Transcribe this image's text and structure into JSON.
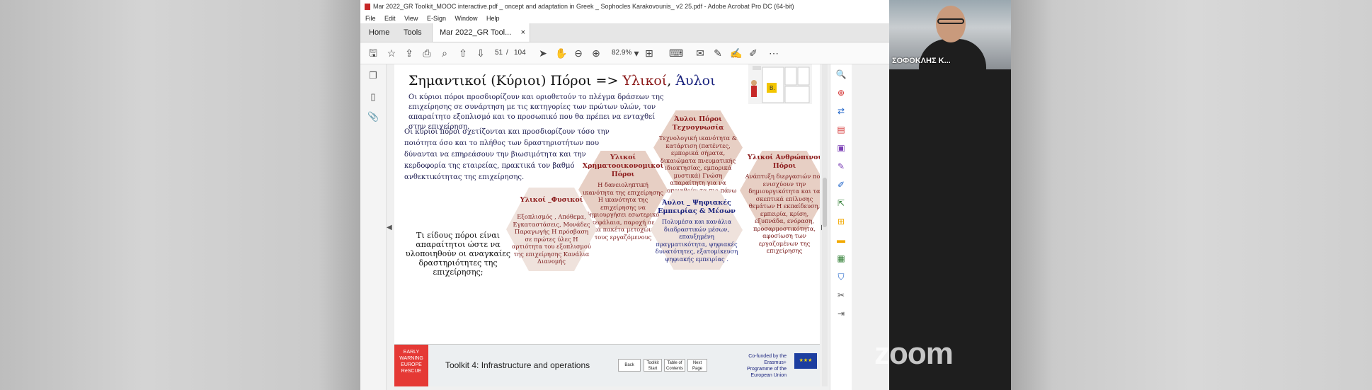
{
  "window": {
    "title": "Mar 2022_GR Toolkit_MOOC interactive.pdf _ oncept and adaptation in Greek _ Sophocles Karakovounis_ v2 25.pdf - Adobe Acrobat Pro DC (64-bit)"
  },
  "menu": [
    "File",
    "Edit",
    "View",
    "E-Sign",
    "Window",
    "Help"
  ],
  "tabs": {
    "home": "Home",
    "tools": "Tools",
    "doc": "Mar 2022_GR Tool...",
    "close": "×"
  },
  "toolbar": {
    "page_current": "51",
    "page_sep": "/",
    "page_total": "104",
    "zoom": "82.9%"
  },
  "icons": {
    "save": "save-icon",
    "star": "star-icon",
    "upload": "upload-icon",
    "print": "print-icon",
    "search": "search-icon",
    "up": "arrow-up-icon",
    "down": "arrow-down-icon",
    "cursor": "cursor-icon",
    "hand": "hand-icon",
    "zoom_out": "zoom-out-icon",
    "zoom_in": "zoom-in-icon"
  },
  "slide": {
    "title_main": "Σημαντικοί (Κύριοι) Πόροι =>",
    "title_red": "Υλικοί",
    "title_sep": ",",
    "title_blue": "Άυλοι",
    "logo_letter": "Β.",
    "para1": "Οι κύριοι πόροι  προσδιορίζουν και οριοθετούν το πλέγμα δράσεων της επιχείρησης σε συνάρτηση με τις κατηγορίες των πρώτων υλών, τον απαραίτητο εξοπλισμό και το προσωπικό που θα πρέπει να ενταχθεί στην επιχείρηση.",
    "para2": "Οι κύριοι πόροι σχετίζονται και προσδιορίζουν τόσο την ποιότητα όσο και το πλήθος των δραστηριοτήτων που δύνανται να επηρεάσουν την βιωσιμότητα και την κερδοφορία της εταιρείας, πρακτικά τον βαθμό ανθεκτικότητας της επιχείρησης.",
    "question": "Τι είδους πόροι είναι απαραίτητοι ώστε να υλοποιηθούν οι αναγκαίες δραστηριότητες της επιχείρησης;",
    "hexes": {
      "tech": {
        "title": "Άυλοι Πόροι Τεχνογνωσία",
        "body": "Τεχνολογική ικανότητα & κατάρτιση (πατέντες, εμπορικά σήματα, δικαιώματα πνευματικής ιδιοκτησίας, εμπορικά μυστικά) Γνώση απαραίτητη για να υλοποιηθούν τα πιο πάνω"
      },
      "human": {
        "title": "Υλικοί Ανθρώπινοι Πόροι",
        "body": "Ανάπτυξη διεργασιών που ενισχύουν την δημιουργικότητα και τα σκεπτικά επίλυσης θεμάτων Η εκπαίδευση, εμπειρία, κρίση, εξυπνάδα, ενόραση, προσαρμοστικότητα, αφοσίωση των εργαζομένων της επιχείρησης"
      },
      "financial": {
        "title": "Υλικοί Χρηματοοικονομικοί Πόροι",
        "body": "Η δανειοληπτική ικανότητα της επιχείρησης Η ικανότητα της επιχείρησης να δημιουργήσει εσωτερικά κεφάλαια, παροχή σε ειδικά πακέτα μετοχών για τους εργαζόμενους"
      },
      "physical": {
        "title": "Υλικοί _Φυσικοί",
        "body": "Εξοπλισμός , Απόθεμα, Εγκαταστάσεις, Μονάδες Παραγωγής Η πρόσβαση σε πρώτες ύλες Η αρτιότητα του εξοπλισμού της επιχείρησης Κανάλια Διανομής"
      },
      "digital": {
        "title": "Άυλοι _ Ψηφιακές Εμπειρίας & Μέσων",
        "body": "Πολυμέσα και κανάλια διαδραστικών μέσων, επαυξημένη πραγματικότητα, ψηφιακές δυνατότητες, εξατομίκευση ψηφιακής εμπειρίας ."
      }
    },
    "footer": {
      "ew_logo": "EARLY WARNING EUROPE ReSCUE",
      "title": "Toolkit 4: Infrastructure and operations",
      "buttons": [
        "Back",
        "Toolkit Start",
        "Table of Contents",
        "Next Page"
      ],
      "cofund": "Co-funded by the Erasmus+ Programme of the European Union"
    }
  },
  "participant": {
    "name": "ΣΟΦΟΚΛΗΣ Κ..."
  },
  "watermark": "zoom"
}
